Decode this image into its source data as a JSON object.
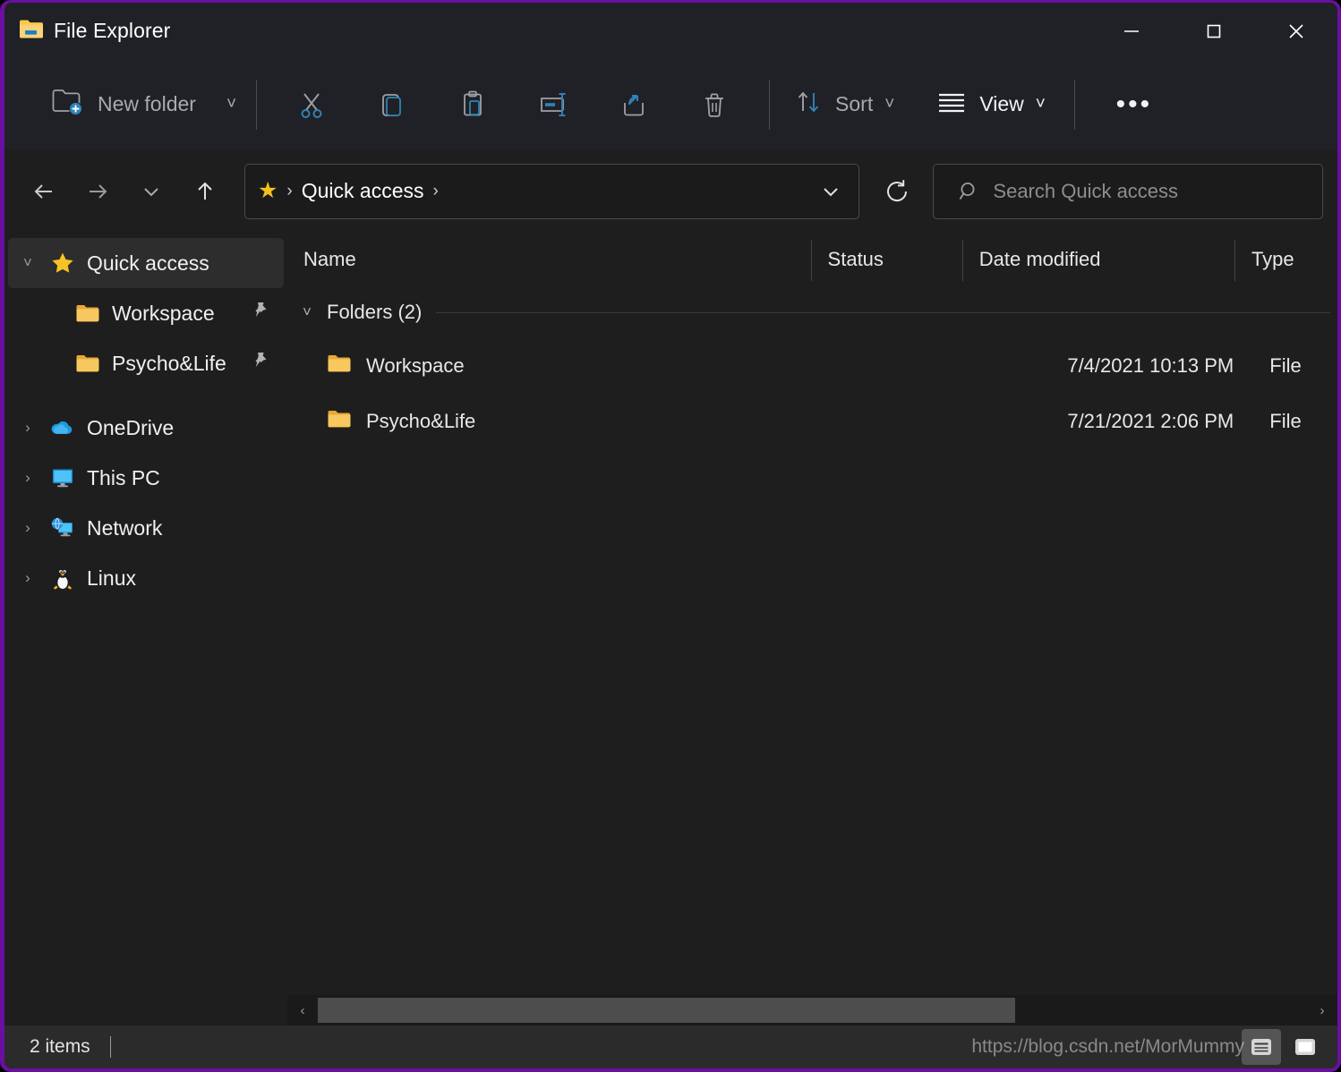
{
  "window": {
    "title": "File Explorer",
    "border_color": "#6B0FA0",
    "titlebar_bg": "#202126",
    "content_bg": "#1e1e1e",
    "accent_blue": "#2f83b8",
    "folder_yellow": "#f2c05c",
    "controls": {
      "minimize": "—",
      "maximize": "□",
      "close": "✕"
    }
  },
  "toolbar": {
    "new_folder_label": "New folder",
    "new_folder_caret": "˅",
    "cut_label": "Cut",
    "copy_label": "Copy",
    "paste_label": "Paste",
    "rename_label": "Rename",
    "share_label": "Share",
    "delete_label": "Delete",
    "sort_label": "Sort",
    "sort_caret": "˅",
    "view_label": "View",
    "view_caret": "˅",
    "more_label": "•••"
  },
  "addressbar": {
    "back_glyph": "←",
    "forward_glyph": "→",
    "recent_glyph": "˅",
    "up_glyph": "↑",
    "star_glyph": "★",
    "crumb_sep": "›",
    "path_label": "Quick access",
    "path_dropdown_glyph": "˅",
    "refresh_glyph": "↻"
  },
  "search": {
    "placeholder": "Search Quick access",
    "value": "",
    "icon": "search-icon"
  },
  "sidebar": {
    "items": [
      {
        "label": "Quick access",
        "icon": "star-icon",
        "chevron": "˅",
        "selected": true,
        "child": false,
        "pinned": false
      },
      {
        "label": "Workspace",
        "icon": "folder-icon",
        "chevron": "",
        "selected": false,
        "child": true,
        "pinned": true
      },
      {
        "label": "Psycho&Life",
        "icon": "folder-icon",
        "chevron": "",
        "selected": false,
        "child": true,
        "pinned": true
      },
      {
        "label": "OneDrive",
        "icon": "cloud-icon",
        "chevron": "›",
        "selected": false,
        "child": false,
        "pinned": false
      },
      {
        "label": "This PC",
        "icon": "monitor-icon",
        "chevron": "›",
        "selected": false,
        "child": false,
        "pinned": false
      },
      {
        "label": "Network",
        "icon": "network-icon",
        "chevron": "›",
        "selected": false,
        "child": false,
        "pinned": false
      },
      {
        "label": "Linux",
        "icon": "penguin-icon",
        "chevron": "›",
        "selected": false,
        "child": false,
        "pinned": false
      }
    ]
  },
  "filelist": {
    "columns": [
      {
        "key": "name",
        "label": "Name"
      },
      {
        "key": "status",
        "label": "Status"
      },
      {
        "key": "date",
        "label": "Date modified"
      },
      {
        "key": "type",
        "label": "Type"
      }
    ],
    "group": {
      "chevron": "˅",
      "label": "Folders (2)"
    },
    "rows": [
      {
        "name": "Workspace",
        "status": "",
        "date": "7/4/2021 10:13 PM",
        "type": "File",
        "icon": "folder-icon"
      },
      {
        "name": "Psycho&Life",
        "status": "",
        "date": "7/21/2021 2:06 PM",
        "type": "File",
        "icon": "folder-icon"
      }
    ]
  },
  "scrollbar": {
    "left_arrow": "‹",
    "right_arrow": "›",
    "thumb_percent": "70.5%"
  },
  "statusbar": {
    "item_count": "2 items",
    "watermark": "https://blog.csdn.net/MorMummy",
    "view_details_label": "Details view",
    "view_largeicons_label": "Large icons view"
  }
}
